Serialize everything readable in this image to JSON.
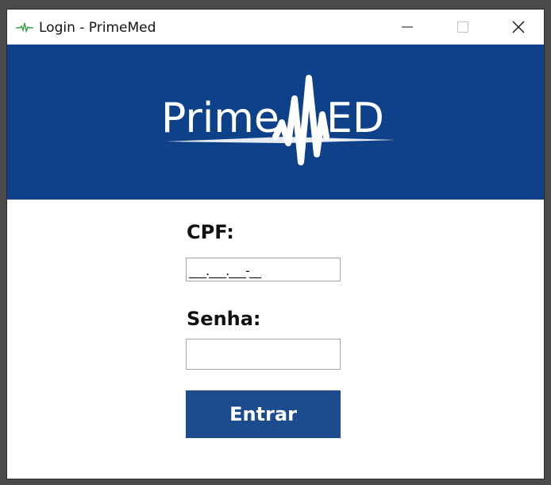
{
  "window": {
    "title": "Login - PrimeMed",
    "controls": [
      "minimize-icon",
      "maximize-icon",
      "close-icon"
    ]
  },
  "banner": {
    "logo_text": "PrimeMED",
    "background": "#0e418a"
  },
  "form": {
    "cpf_label": "CPF:",
    "cpf_value": "___.___.___-__",
    "senha_label": "Senha:",
    "senha_value": "",
    "submit_label": "Entrar",
    "button_color": "#1c4c8e"
  }
}
